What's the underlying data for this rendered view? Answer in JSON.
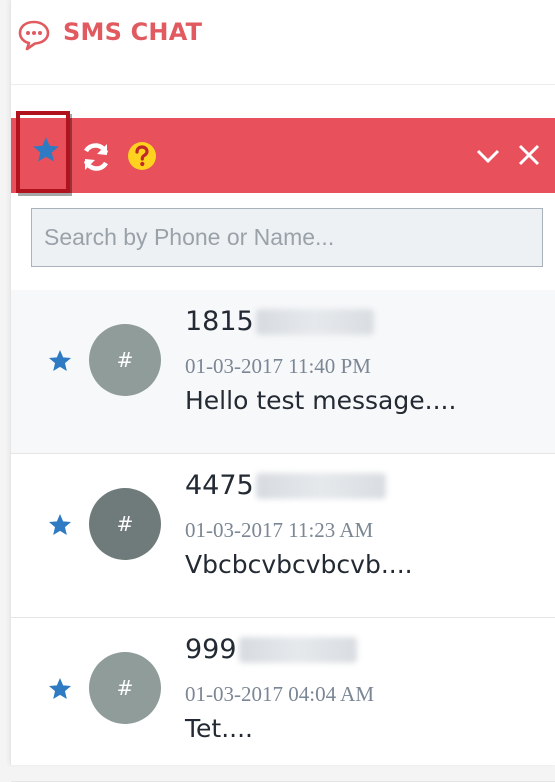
{
  "header": {
    "title": "SMS CHAT"
  },
  "colors": {
    "accent": "#e8505b",
    "title": "#e05a5f",
    "star": "#2e7bc4",
    "highlight_border": "#b0121e"
  },
  "toolbar": {
    "icons": [
      "star-icon",
      "refresh-icon",
      "help-icon",
      "chevron-down-icon",
      "close-icon"
    ]
  },
  "search": {
    "placeholder": "Search by Phone or Name...",
    "value": ""
  },
  "conversations": [
    {
      "phone_visible": "1815",
      "timestamp": "01-03-2017 11:40 PM",
      "preview": "Hello test message....",
      "avatar_label": "#",
      "avatar_color": "#8f9c9a"
    },
    {
      "phone_visible": "4475",
      "timestamp": "01-03-2017 11:23 AM",
      "preview": "Vbcbcvbcvbcvb....",
      "avatar_label": "#",
      "avatar_color": "#6f7b7a"
    },
    {
      "phone_visible": "999",
      "timestamp": "01-03-2017 04:04 AM",
      "preview": "Tet....",
      "avatar_label": "#",
      "avatar_color": "#8f9c9a"
    }
  ]
}
